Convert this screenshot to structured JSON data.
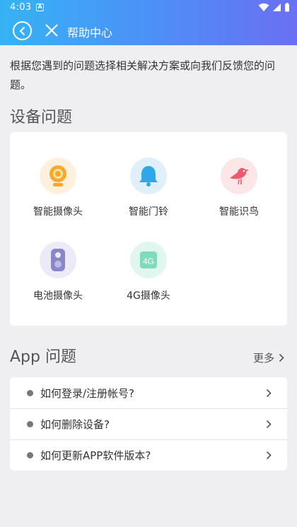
{
  "status": {
    "time": "4:03",
    "notify_glyph": "A"
  },
  "nav": {
    "title": "帮助中心"
  },
  "intro": "根据您遇到的问题选择相关解决方案或向我们反馈您的问题。",
  "device_section": {
    "title": "设备问题",
    "items": [
      {
        "label": "智能摄像头",
        "icon": "camera-icon",
        "color": "#f7a928"
      },
      {
        "label": "智能门铃",
        "icon": "bell-icon",
        "color": "#2fa7e8"
      },
      {
        "label": "智能识鸟",
        "icon": "bird-icon",
        "color": "#ec5b6b"
      },
      {
        "label": "电池摄像头",
        "icon": "battery-camera-icon",
        "color": "#8a86c8"
      },
      {
        "label": "4G摄像头",
        "icon": "4g-camera-icon",
        "color": "#3fc59a"
      }
    ]
  },
  "app_section": {
    "title": "App 问题",
    "more_label": "更多",
    "items": [
      {
        "label": "如何登录/注册帐号?"
      },
      {
        "label": "如何删除设备?"
      },
      {
        "label": "如何更新APP软件版本?"
      }
    ]
  },
  "colors": {
    "accent_start": "#35b3f5",
    "accent_end": "#6a6ff3",
    "background": "#efeff1"
  }
}
